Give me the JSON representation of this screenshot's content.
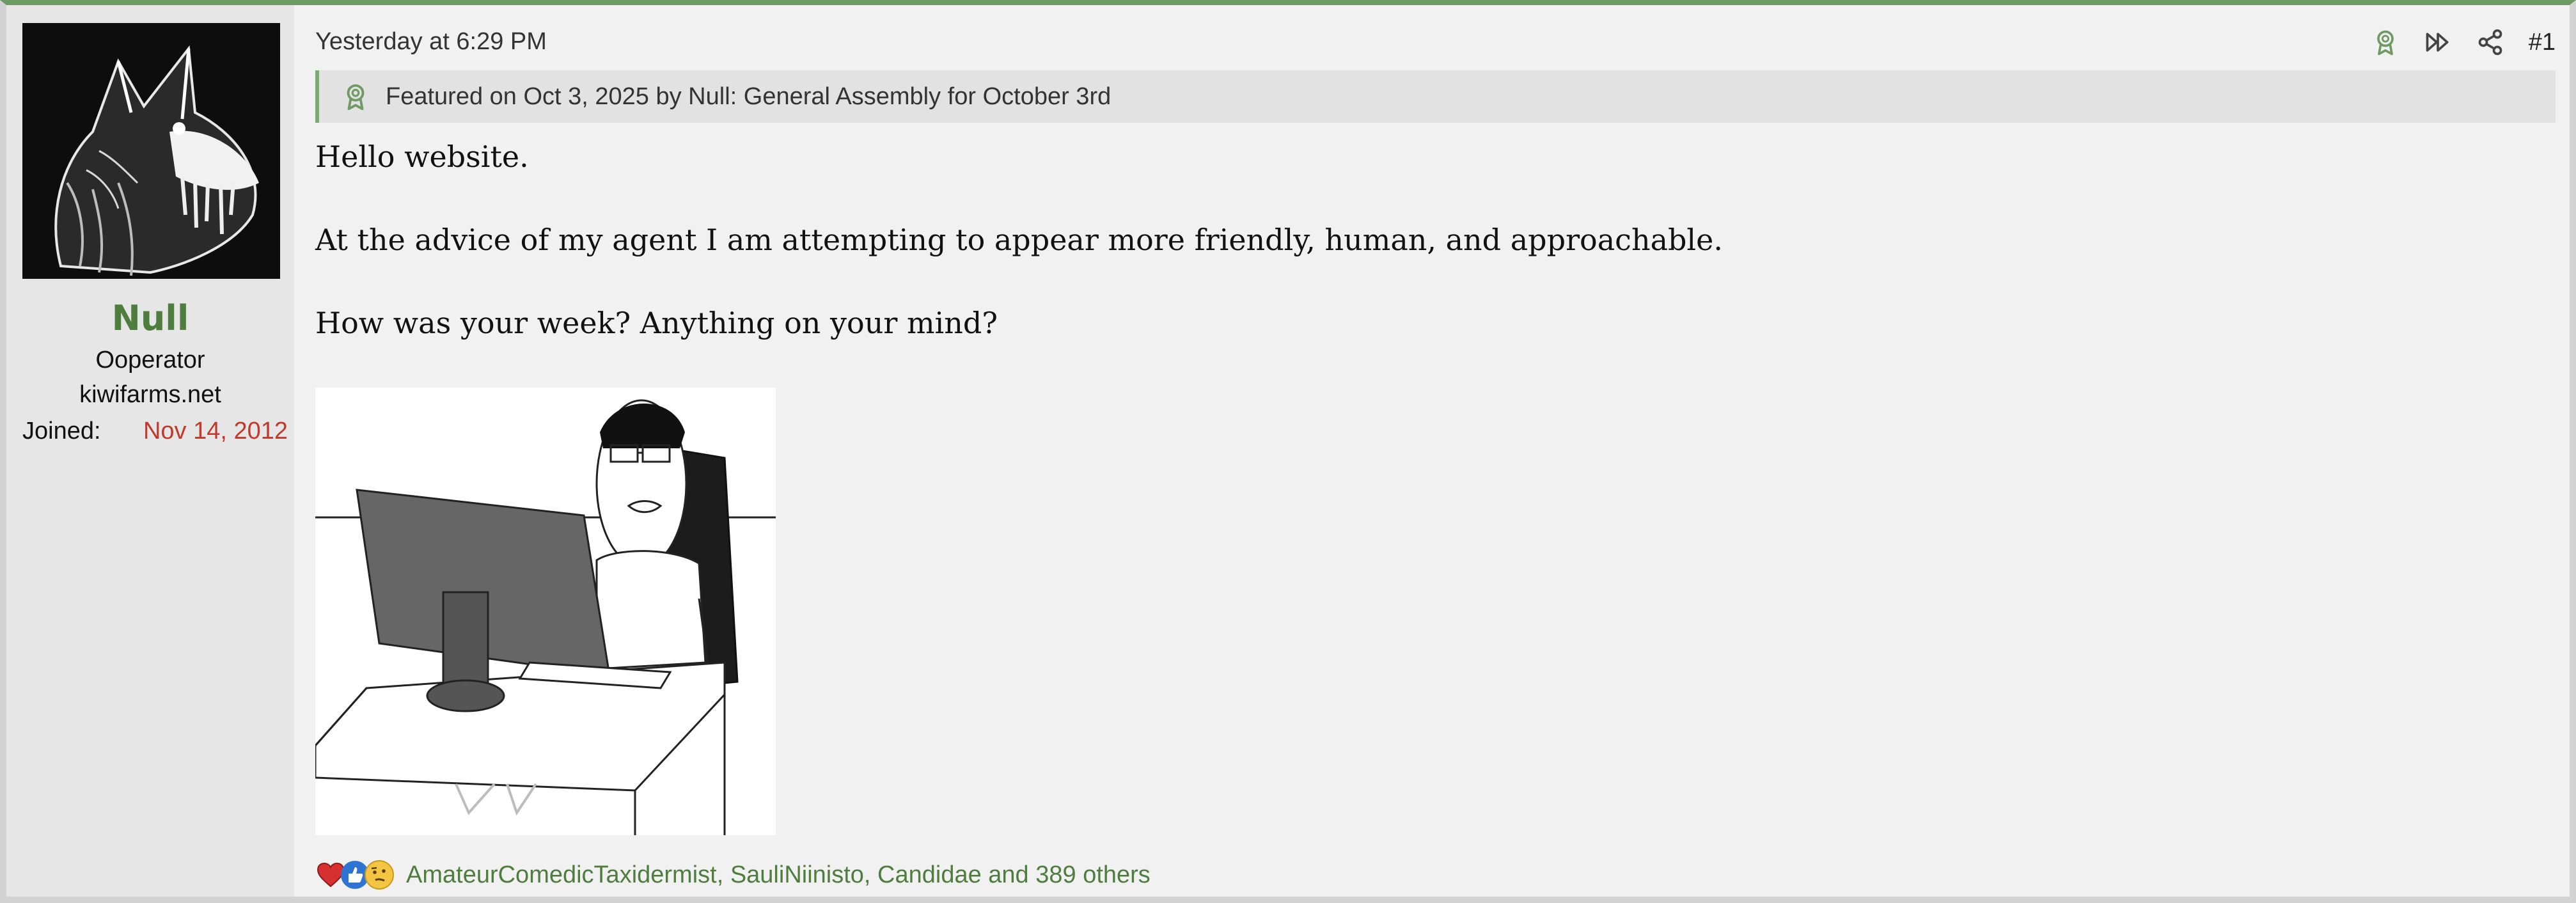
{
  "user": {
    "name": "Null",
    "title": "Ooperator",
    "site": "kiwifarms.net",
    "joined_label": "Joined:",
    "joined_date": "Nov 14, 2012"
  },
  "post": {
    "timestamp": "Yesterday at 6:29 PM",
    "number": "#1",
    "featured_text": "Featured on Oct 3, 2025 by Null: General Assembly for October 3rd",
    "body": [
      "Hello website.",
      "At the advice of my agent I am attempting to appear more friendly, human, and approachable.",
      "How was your week? Anything on your mind?"
    ],
    "reactions": {
      "icons": [
        "heart-icon",
        "thumbs-up-icon",
        "thinking-face-icon"
      ],
      "users_text": "AmateurComedicTaxidermist, SauliNiinisto, Candidae and 389 others"
    }
  },
  "icons": {
    "featured": "award-ribbon-icon",
    "actions": [
      "award-ribbon-icon",
      "fast-forward-icon",
      "share-icon"
    ]
  },
  "colors": {
    "accent": "#6f9a63",
    "username": "#4f7d3e",
    "joined_date": "#c0392b",
    "link": "#4f7d3e"
  }
}
